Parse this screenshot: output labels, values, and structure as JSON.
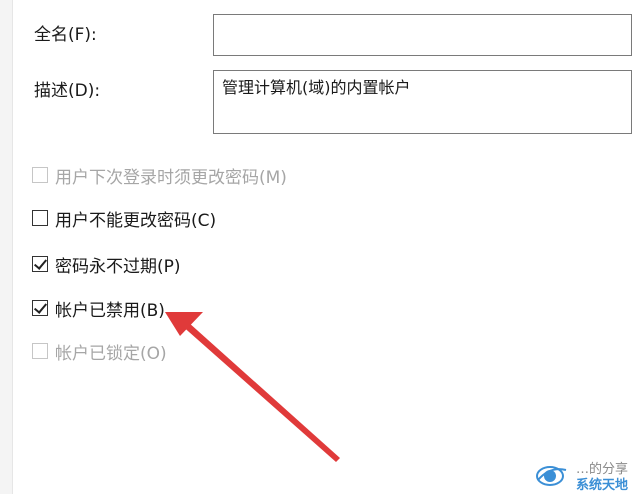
{
  "form": {
    "fullname_label": "全名(F):",
    "fullname_value": "",
    "description_label": "描述(D):",
    "description_value": "管理计算机(域)的内置帐户"
  },
  "options": [
    {
      "label": "用户下次登录时须更改密码(M)",
      "checked": false,
      "enabled": false
    },
    {
      "label": "用户不能更改密码(C)",
      "checked": false,
      "enabled": true
    },
    {
      "label": "密码永不过期(P)",
      "checked": true,
      "enabled": true
    },
    {
      "label": "帐户已禁用(B)",
      "checked": true,
      "enabled": true
    },
    {
      "label": "帐户已锁定(O)",
      "checked": false,
      "enabled": false
    }
  ],
  "annotation": {
    "arrow_color": "#e03a3a"
  },
  "watermark": {
    "caption": "…的分享",
    "brand": "系统天地"
  }
}
